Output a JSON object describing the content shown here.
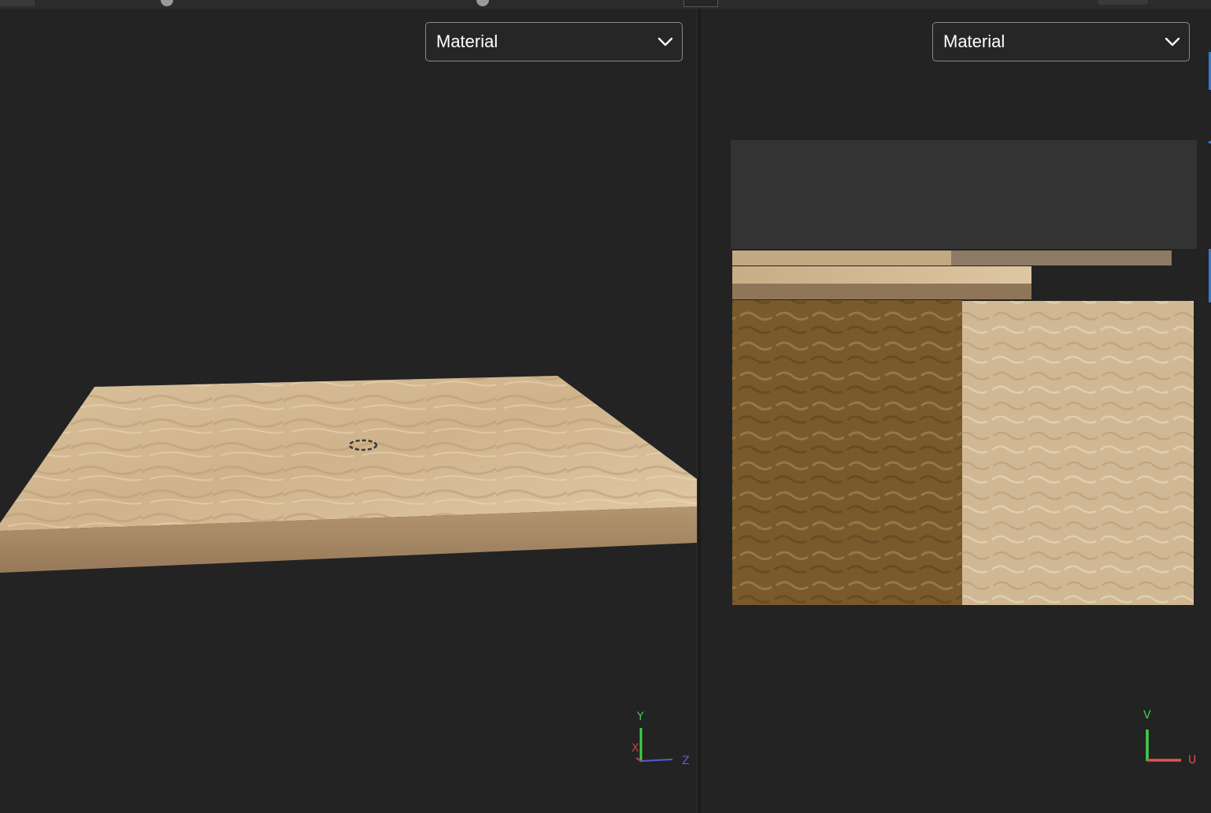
{
  "viewport3d": {
    "display_mode": {
      "selected": "Material"
    },
    "axis_gizmo": {
      "up": "Y",
      "right": "Z",
      "depth": "X"
    }
  },
  "uv_editor": {
    "display_mode": {
      "selected": "Material"
    },
    "axis_gizmo": {
      "up": "V",
      "right": "U"
    }
  },
  "colors": {
    "background": "#232323",
    "sand": "#cdb18a",
    "sand_dark": "#8a6a3e",
    "sand_side": "#a88964",
    "axis_y": "#3fd04a",
    "axis_z": "#5a5ad8",
    "axis_x": "#c94040",
    "axis_u": "#e0505a",
    "accent_blue": "#3a79c9"
  },
  "icons": [
    "chevron-down-icon",
    "pivot-gizmo-icon"
  ]
}
